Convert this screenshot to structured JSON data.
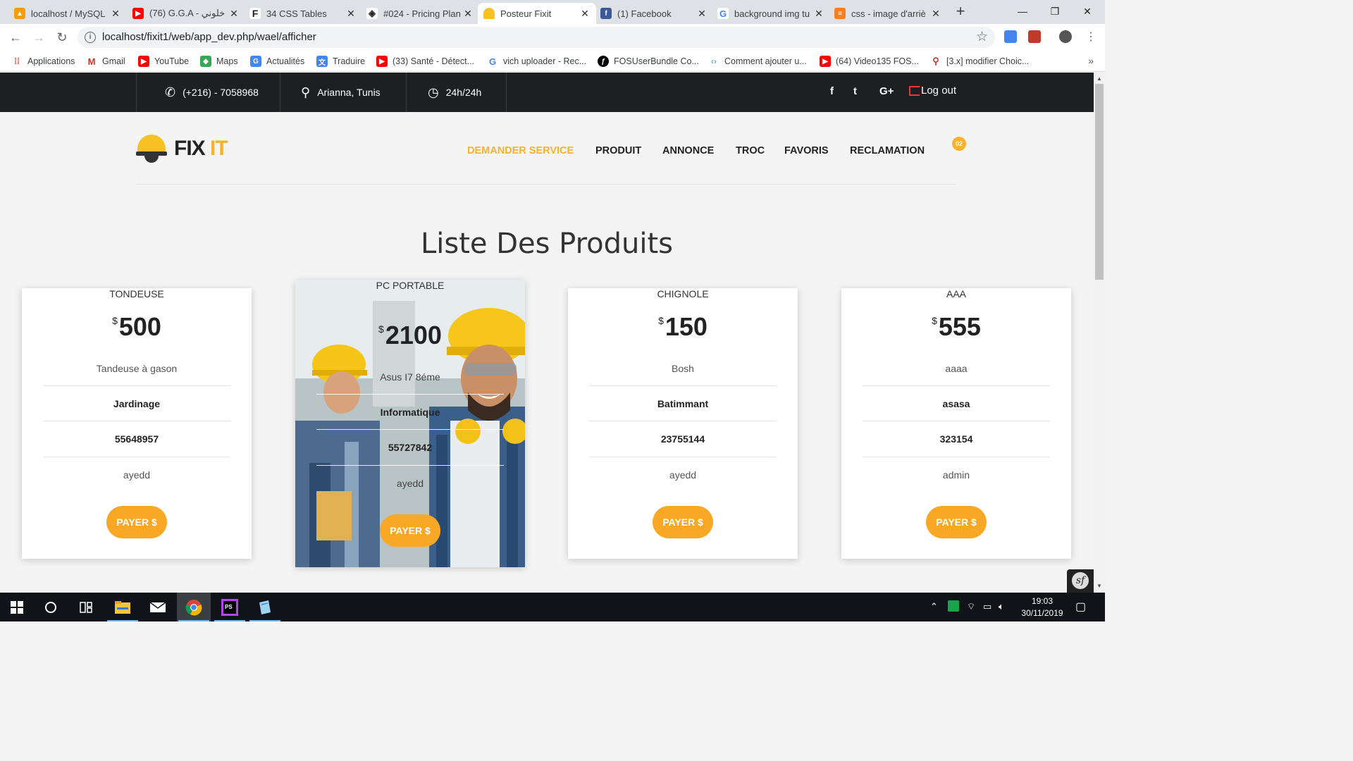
{
  "browser": {
    "tabs": [
      {
        "title": "localhost / MySQL",
        "icon": "phpmyadmin-icon",
        "color": "#f89c0e"
      },
      {
        "title": "(76) G.G.A - خلوني",
        "icon": "youtube-icon",
        "color": "#ff0000"
      },
      {
        "title": "34 CSS Tables",
        "icon": "f-icon",
        "color": "#222222"
      },
      {
        "title": "#024 - Pricing Plan",
        "icon": "codepen-icon",
        "color": "#222222"
      },
      {
        "title": "Posteur Fixit",
        "icon": "helmet-icon",
        "color": "#f9c224"
      },
      {
        "title": "(1) Facebook",
        "icon": "facebook-icon",
        "color": "#3b5998"
      },
      {
        "title": "background img tu",
        "icon": "google-icon",
        "color": "#4285f4"
      },
      {
        "title": "css - image d'arriè",
        "icon": "stackoverflow-icon",
        "color": "#f48024"
      }
    ],
    "active_tab": 4,
    "new_tab": "+",
    "url": "localhost/fixit1/web/app_dev.php/wael/afficher",
    "window_controls": {
      "minimize": "—",
      "maximize": "❐",
      "close": "✕"
    }
  },
  "bookmarks": [
    {
      "label": "Applications",
      "icon": "apps-grid-icon",
      "color": "#ea4335"
    },
    {
      "label": "Gmail",
      "icon": "gmail-icon",
      "color": "#d93025"
    },
    {
      "label": "YouTube",
      "icon": "youtube-icon",
      "color": "#ff0000"
    },
    {
      "label": "Maps",
      "icon": "maps-icon",
      "color": "#34a853"
    },
    {
      "label": "Actualités",
      "icon": "news-icon",
      "color": "#4285f4"
    },
    {
      "label": "Traduire",
      "icon": "translate-icon",
      "color": "#4285f4"
    },
    {
      "label": "(33) Santé - Détect...",
      "icon": "youtube-icon",
      "color": "#ff0000"
    },
    {
      "label": "vich uploader - Rec...",
      "icon": "google-icon",
      "color": "#4285f4"
    },
    {
      "label": "FOSUserBundle Co...",
      "icon": "symfony-icon",
      "color": "#000000"
    },
    {
      "label": "Comment ajouter u...",
      "icon": "link-icon",
      "color": "#6fa8dc"
    },
    {
      "label": "(64) Video135 FOS...",
      "icon": "youtube-icon",
      "color": "#ff0000"
    },
    {
      "label": "[3.x] modifier Choic...",
      "icon": "pin-icon",
      "color": "#c0392b"
    }
  ],
  "site": {
    "topbar": {
      "phone": "(+216) - 7058968",
      "location": "Arianna, Tunis",
      "hours": "24h/24h",
      "social": [
        "f",
        "t",
        "G+"
      ],
      "logout": "Log out"
    },
    "logo": {
      "part1": "FIX",
      "part2": "IT"
    },
    "menu": [
      "DEMANDER SERVICE",
      "PRODUIT",
      "ANNONCE",
      "TROC",
      "FAVORIS",
      "RECLAMATION"
    ],
    "active_menu": 0,
    "cart_count": "02",
    "accent_color": "#f9b22b",
    "title": "Liste Des Produits",
    "products": [
      {
        "name": "TONDEUSE",
        "currency": "$",
        "price": "500",
        "description": "Tandeuse à gason",
        "category": "Jardinage",
        "phone": "55648957",
        "owner": "ayedd",
        "button": "PAYER $"
      },
      {
        "name": "PC PORTABLE",
        "currency": "$",
        "price": "2100",
        "description": "Asus I7 8éme",
        "category": "Informatique",
        "phone": "55727842",
        "owner": "ayedd",
        "button": "PAYER $"
      },
      {
        "name": "CHIGNOLE",
        "currency": "$",
        "price": "150",
        "description": "Bosh",
        "category": "Batimmant",
        "phone": "23755144",
        "owner": "ayedd",
        "button": "PAYER $"
      },
      {
        "name": "AAA",
        "currency": "$",
        "price": "555",
        "description": "aaaa",
        "category": "asasa",
        "phone": "323154",
        "owner": "admin",
        "button": "PAYER $"
      }
    ]
  },
  "taskbar": {
    "apps": [
      "windows-start-icon",
      "search-circle-icon",
      "task-view-icon",
      "file-explorer-icon",
      "mail-icon",
      "chrome-icon",
      "phpstorm-icon",
      "notepad-icon"
    ],
    "clock_time": "19:03",
    "clock_date": "30/11/2019"
  }
}
